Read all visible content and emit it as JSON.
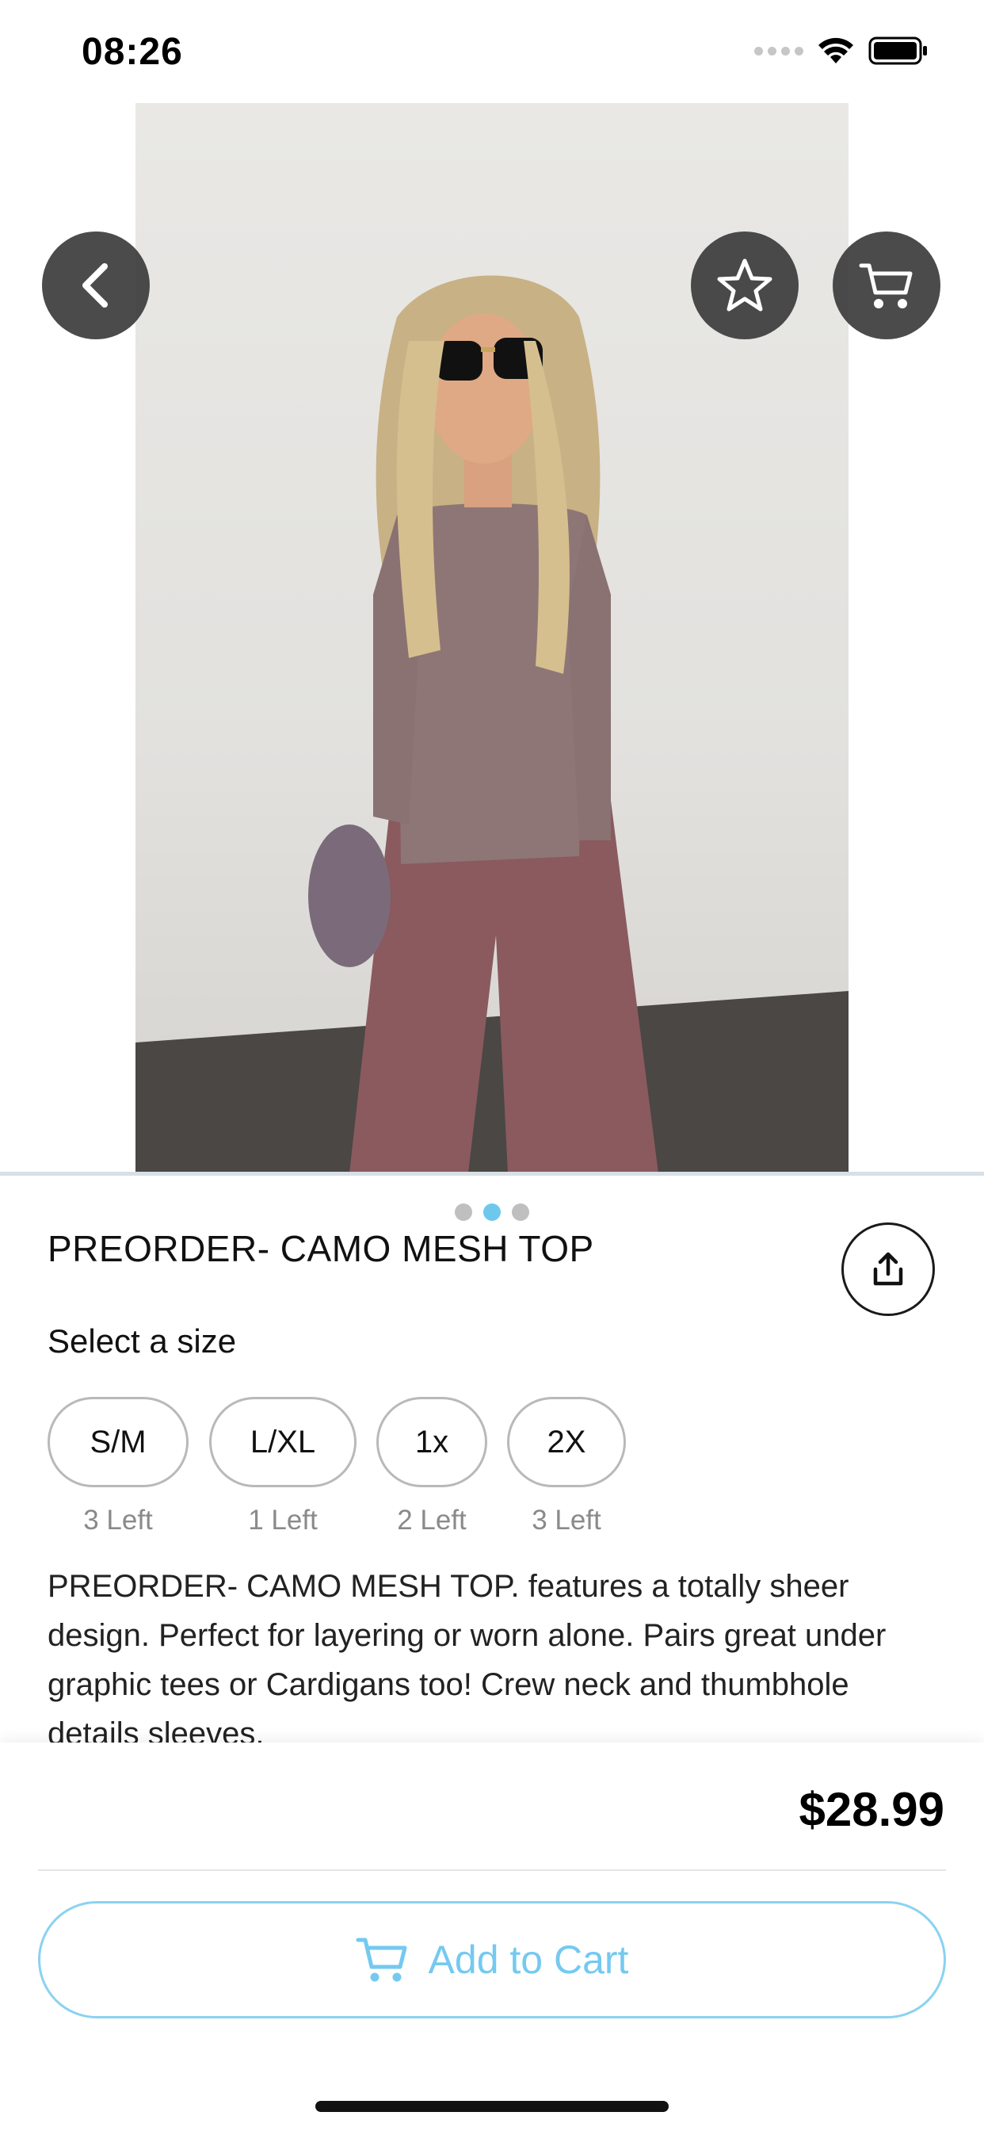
{
  "status_bar": {
    "time": "08:26",
    "icons": [
      "signal-icon",
      "wifi-icon",
      "battery-icon"
    ]
  },
  "hero": {
    "image_alt": "Model wearing camo mesh top",
    "pager": {
      "count": 3,
      "active_index": 1
    },
    "buttons": [
      "back-chevron-icon",
      "star-icon",
      "cart-icon"
    ]
  },
  "product": {
    "title": "PREORDER- CAMO MESH TOP",
    "size_prompt": "Select a size",
    "sizes": [
      {
        "label": "S/M",
        "stock": "3 Left"
      },
      {
        "label": "L/XL",
        "stock": "1 Left"
      },
      {
        "label": "1x",
        "stock": "2 Left"
      },
      {
        "label": "2X",
        "stock": "3 Left"
      }
    ],
    "description": "PREORDER- CAMO MESH TOP. features a totally sheer design.  Perfect for layering or worn alone. Pairs great under graphic tees or  Cardigans too! Crew neck and thumbhole details sleeves."
  },
  "checkout": {
    "price": "$28.99",
    "add_to_cart_label": "Add to Cart"
  },
  "colors": {
    "accent": "#74c9f0",
    "button_dark": "#3c3c3c",
    "pager_inactive": "#bfbfbf"
  }
}
